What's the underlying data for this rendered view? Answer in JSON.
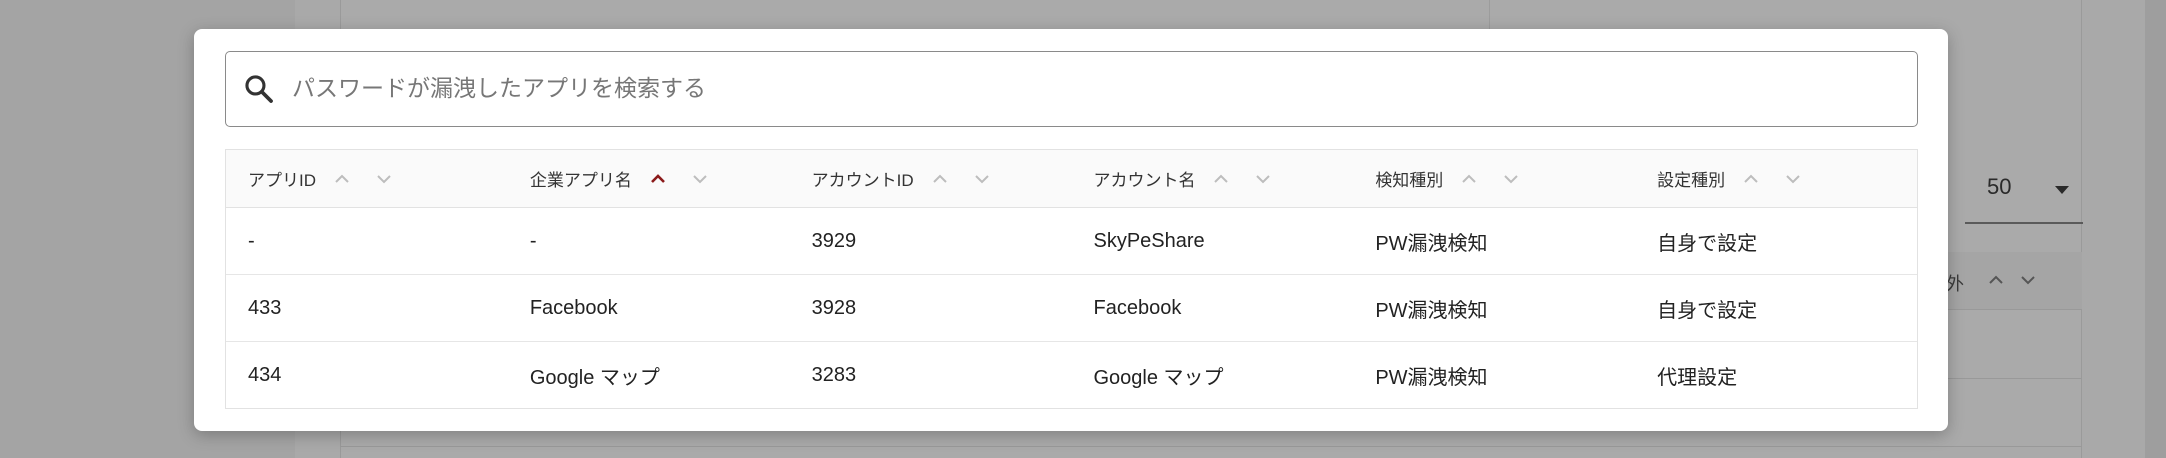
{
  "background": {
    "page_size_select": {
      "value": "50"
    },
    "table_header": {
      "label": "外"
    }
  },
  "modal": {
    "search": {
      "placeholder": "パスワードが漏洩したアプリを検索する",
      "value": ""
    },
    "table": {
      "columns": [
        {
          "label": "アプリID",
          "sort": "none"
        },
        {
          "label": "企業アプリ名",
          "sort": "ascending"
        },
        {
          "label": "アカウントID",
          "sort": "none"
        },
        {
          "label": "アカウント名",
          "sort": "none"
        },
        {
          "label": "検知種別",
          "sort": "none"
        },
        {
          "label": "設定種別",
          "sort": "none"
        }
      ],
      "rows": [
        {
          "app_id": "-",
          "corp_app_name": "-",
          "account_id": "3929",
          "account_name": "SkyPeShare",
          "detection_type": "PW漏洩検知",
          "setting_type": "自身で設定"
        },
        {
          "app_id": "433",
          "corp_app_name": "Facebook",
          "account_id": "3928",
          "account_name": "Facebook",
          "detection_type": "PW漏洩検知",
          "setting_type": "自身で設定"
        },
        {
          "app_id": "434",
          "corp_app_name": "Google マップ",
          "account_id": "3283",
          "account_name": "Google マップ",
          "detection_type": "PW漏洩検知",
          "setting_type": "代理設定"
        }
      ]
    }
  },
  "colors": {
    "sort_active": "#8b1a1a",
    "sort_inactive": "#bdbdbd",
    "overlay": "#9e9e9e"
  },
  "icons": {
    "search": "search-icon",
    "sort_up": "chevron-up-icon",
    "sort_down": "chevron-down-icon"
  }
}
